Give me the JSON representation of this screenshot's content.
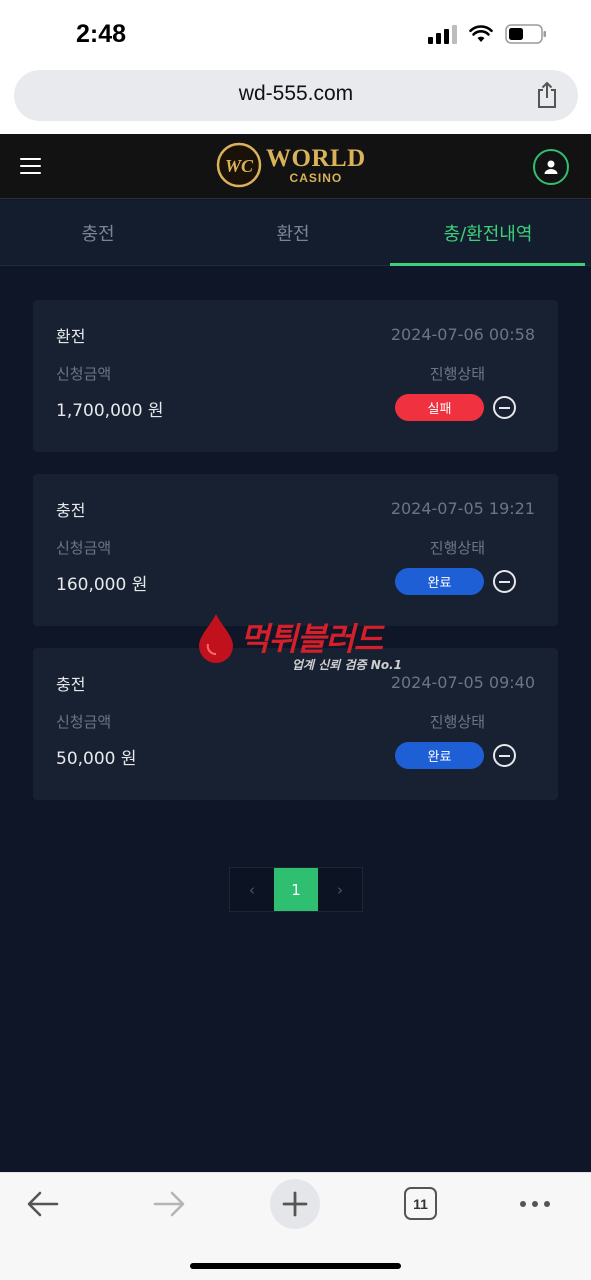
{
  "status_bar": {
    "time": "2:48"
  },
  "browser": {
    "url": "wd-555.com",
    "tab_count": "11"
  },
  "logo": {
    "main": "WORLD",
    "sub": "CASINO"
  },
  "tabs": [
    {
      "label": "충전"
    },
    {
      "label": "환전"
    },
    {
      "label": "충/환전내역"
    }
  ],
  "labels": {
    "amount": "신청금액",
    "status": "진행상태"
  },
  "records": [
    {
      "type": "환전",
      "date": "2024-07-06 00:58",
      "amount": "1,700,000 원",
      "status": "실패",
      "status_color": "#f0313f"
    },
    {
      "type": "충전",
      "date": "2024-07-05 19:21",
      "amount": "160,000 원",
      "status": "완료",
      "status_color": "#1f5fd6"
    },
    {
      "type": "충전",
      "date": "2024-07-05 09:40",
      "amount": "50,000 원",
      "status": "완료",
      "status_color": "#1f5fd6"
    }
  ],
  "pagination": {
    "prev": "‹",
    "current": "1",
    "next": "›"
  },
  "watermark": {
    "title": "먹튀블러드",
    "subtitle": "업계 신뢰 검증 No.1"
  },
  "colors": {
    "accent": "#3ecf7a",
    "background": "#0e1627",
    "card": "#172131",
    "gold": "#d9b25a"
  }
}
